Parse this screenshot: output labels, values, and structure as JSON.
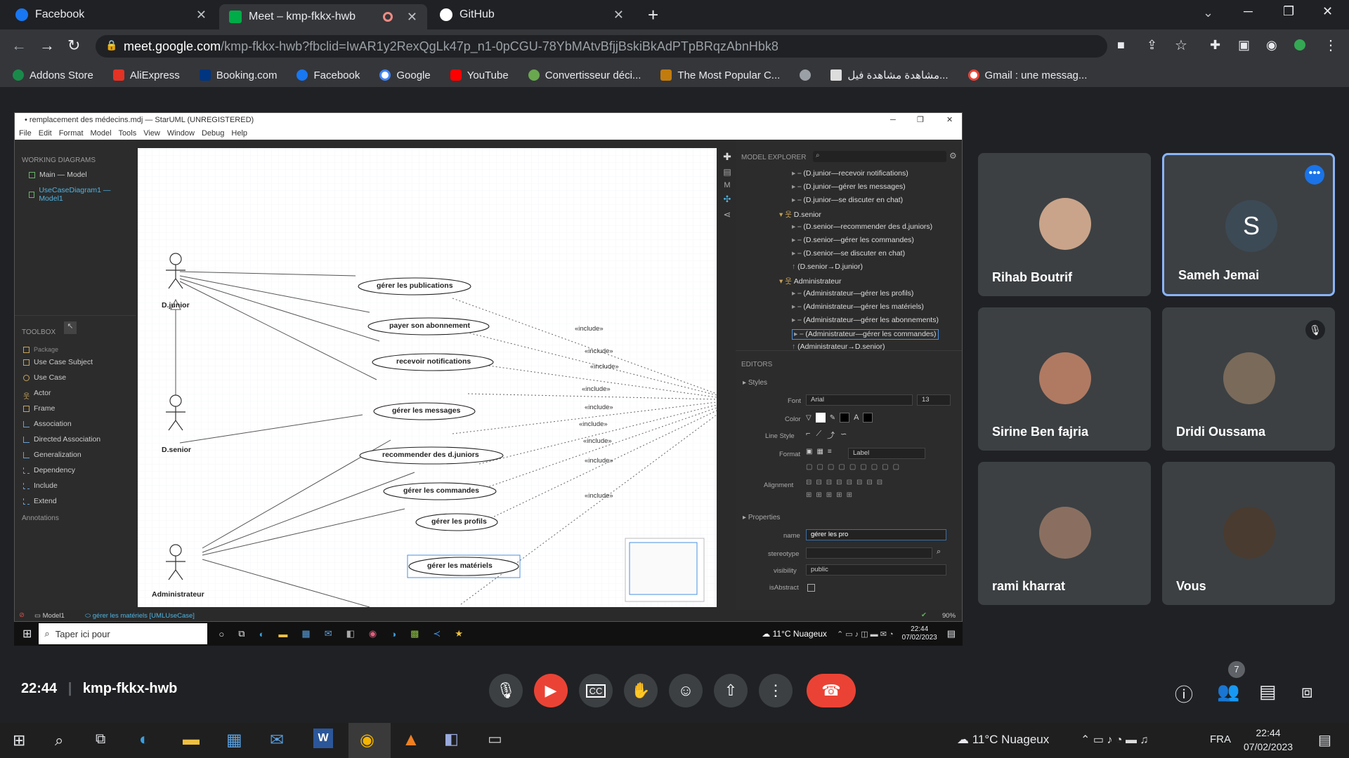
{
  "browser": {
    "tabs": [
      {
        "title": "Facebook"
      },
      {
        "title": "Meet – kmp-fkkx-hwb"
      },
      {
        "title": "GitHub"
      }
    ],
    "url_host": "meet.google.com",
    "url_path": "/kmp-fkkx-hwb?fbclid=IwAR1y2RexQgLk47p_n1-0pCGU-78YbMAtvBfjjBskiBkAdPTpBRqzAbnHbk8",
    "bookmarks": [
      "Addons Store",
      "AliExpress",
      "Booking.com",
      "Facebook",
      "Google",
      "YouTube",
      "Convertisseur déci...",
      "The Most Popular C...",
      "مشاهدة مشاهدة فيل...",
      "Gmail : une messag..."
    ]
  },
  "staruml": {
    "title": "• remplacement des médecins.mdj — StarUML (UNREGISTERED)",
    "menu": [
      "File",
      "Edit",
      "Format",
      "Model",
      "Tools",
      "View",
      "Window",
      "Debug",
      "Help"
    ],
    "working_diagrams_label": "WORKING DIAGRAMS",
    "diagrams": [
      "Main — Model",
      "UseCaseDiagram1 — Model1"
    ],
    "toolbox_label": "TOOLBOX",
    "toolbox_items": [
      "Package",
      "Use Case Subject",
      "Use Case",
      "Actor",
      "Frame",
      "Association",
      "Directed Association",
      "Generalization",
      "Dependency",
      "Include",
      "Extend"
    ],
    "annotations_label": "Annotations",
    "actors": [
      "D.junior",
      "D.senior",
      "Administrateur"
    ],
    "usecases": [
      "gérer les publications",
      "payer son abonnement",
      "recevoir notifications",
      "gérer les messages",
      "recommender des d.juniors",
      "gérer les commandes",
      "gérer les profils",
      "gérer les matériels"
    ],
    "include_label": "«include»",
    "model_explorer_label": "MODEL EXPLORER",
    "tree": [
      "(D.junior—recevoir notifications)",
      "(D.junior—gérer les messages)",
      "(D.junior—se discuter en chat)",
      "D.senior",
      "(D.senior—recommender des d.juniors)",
      "(D.senior—gérer les commandes)",
      "(D.senior—se discuter en chat)",
      "(D.senior→D.junior)",
      "Administrateur",
      "(Administrateur—gérer les profils)",
      "(Administrateur—gérer les matériels)",
      "(Administrateur—gérer les abonnements)",
      "(Administrateur—gérer les commandes)",
      "(Administrateur→D.senior)"
    ],
    "editors_label": "EDITORS",
    "styles_label": "Styles",
    "font_label": "Font",
    "font_value": "Arial",
    "font_size": "13",
    "color_label": "Color",
    "line_style_label": "Line Style",
    "format_label": "Format",
    "format_value": "Label",
    "alignment_label": "Alignment",
    "properties_label": "Properties",
    "name_label": "name",
    "name_value": "gérer les pro",
    "stereotype_label": "stereotype",
    "visibility_label": "visibility",
    "visibility_value": "public",
    "isabstract_label": "isAbstract",
    "status_model": "Model1",
    "status_element": "gérer les matériels [UMLUseCase]",
    "zoom": "90%"
  },
  "inner_taskbar": {
    "search_placeholder": "Taper ici pour",
    "weather": "11°C Nuageux",
    "time": "22:44",
    "date": "07/02/2023"
  },
  "meet": {
    "participants": [
      {
        "name": "Rihab Boutrif",
        "avatar_color": "#c9a48a"
      },
      {
        "name": "Sameh Jemai",
        "initial": "S",
        "avatar_color": "#3c4a56"
      },
      {
        "name": "Sirine Ben fajria",
        "avatar_color": "#b07a62"
      },
      {
        "name": "Dridi Oussama",
        "avatar_color": "#7a6a5a"
      },
      {
        "name": "rami kharrat",
        "avatar_color": "#8a6f60"
      },
      {
        "name": "Vous",
        "avatar_color": "#4a3b30"
      }
    ],
    "time": "22:44",
    "meeting_code": "kmp-fkkx-hwb",
    "participant_count": "7",
    "accent_red": "#ea4335",
    "accent_blue": "#8ab4f8"
  },
  "windows_taskbar": {
    "weather": "11°C Nuageux",
    "lang": "FRA",
    "time": "22:44",
    "date": "07/02/2023"
  }
}
